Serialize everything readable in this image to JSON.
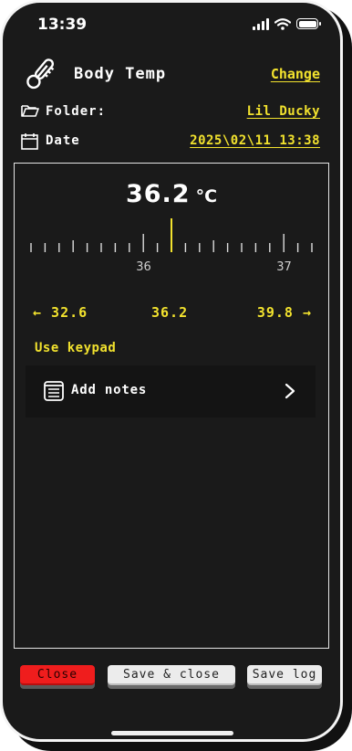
{
  "status_bar": {
    "time": "13:39",
    "icons": [
      "signal-icon",
      "wifi-icon",
      "battery-icon"
    ]
  },
  "header": {
    "icon": "thermometer-icon",
    "title": "Body Temp",
    "change_label": "Change"
  },
  "folder": {
    "icon": "folder-icon",
    "label": "Folder:",
    "value": "Lil Ducky"
  },
  "date": {
    "icon": "calendar-icon",
    "label": "Date",
    "value": "2025\\02\\11 13:38"
  },
  "reading": {
    "value": "36.2",
    "unit": "°C"
  },
  "ruler": {
    "current": 36.2,
    "labels": [
      "36",
      "37"
    ]
  },
  "range": {
    "low": "← 32.6",
    "current": "36.2",
    "high": "39.8 →"
  },
  "keypad_label": "Use keypad",
  "notes": {
    "icon": "notes-icon",
    "label": "Add notes",
    "chevron": "chevron-right-icon"
  },
  "buttons": {
    "close": "Close",
    "save_close": "Save & close",
    "save_log": "Save log"
  },
  "colors": {
    "background": "#1a1a1a",
    "accent": "#f2e22e",
    "danger": "#ef1d1d",
    "light_button": "#ececec"
  }
}
